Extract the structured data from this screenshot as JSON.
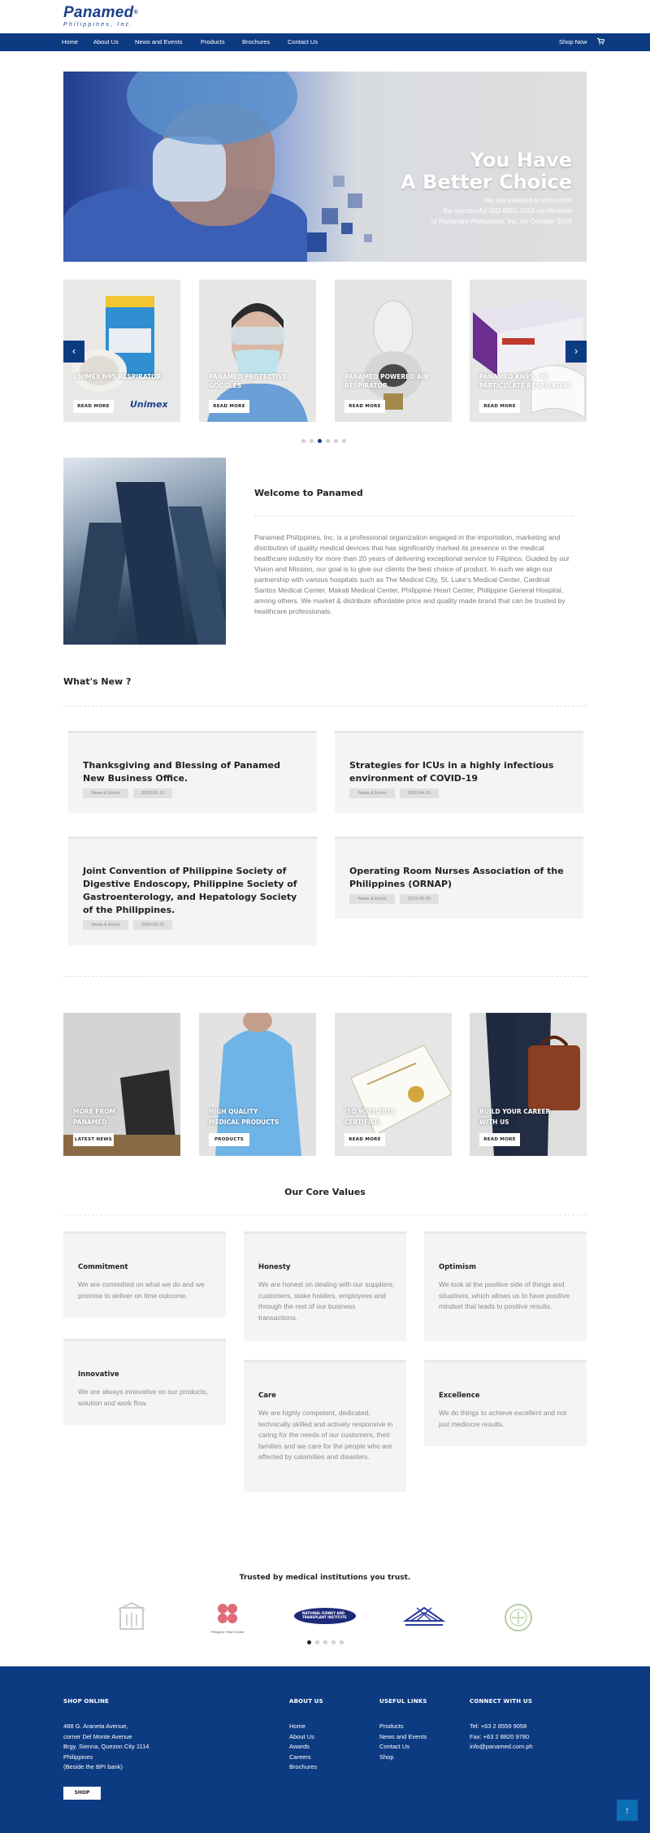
{
  "brand": {
    "name": "Panamed",
    "registered": "®",
    "subtitle": "Philippines, Inc."
  },
  "nav": {
    "items": [
      "Home",
      "About Us",
      "News and Events",
      "Products",
      "Brochures",
      "Contact Us"
    ],
    "shop": "Shop Now",
    "cart_icon": "cart-icon"
  },
  "hero": {
    "title_line1": "You Have",
    "title_line2": "A Better Choice",
    "text_line1": "We are pleased to announce",
    "text_line2": "the successful ISO 9001:2015 certification",
    "text_line3": "of Panamed Philippines, Inc. on October 2018"
  },
  "products": [
    {
      "label": "UNIMEX N95 RESPIRATOR",
      "button": "READ MORE",
      "brand_mark": "Unimex"
    },
    {
      "label": "PANAMED PROTECTIVE GOGGLES",
      "button": "READ MORE"
    },
    {
      "label": "PANAMED POWERED AIR RESPIRATOR",
      "button": "READ MORE"
    },
    {
      "label": "PANAMED KN95 - W PARTICULATE RESPIRATOR",
      "button": "READ MORE"
    }
  ],
  "carousel": {
    "prev_icon": "chevron-left-icon",
    "next_icon": "chevron-right-icon",
    "prev": "‹",
    "next": "›",
    "slide_count": 6,
    "active_index": 2
  },
  "welcome": {
    "title": "Welcome to Panamed",
    "text": "Panamed Philippines, Inc. is a professional organization engaged in the importation, marketing and distribution of quality medical  devices  that has significantly marked its presence in the medical healthcare industry for more than 20 years of delivering exceptional service to Filipinos. Guided by our Vision and Mission, our goal is to give our clients the best choice of product. In such we align our partnership with various hospitals such as The Medical City, St. Luke's Medical Center, Cardinal Santos Medical  Center, Makati Medical Center, Philippine Heart Center, Philippine General Hospital, among others. We market & distribute  affordable price and quality made brand that can be trusted by healthcare professionals."
  },
  "whats_new": {
    "heading": "What's New ?",
    "items": [
      {
        "title": "Thanksgiving and Blessing of Panamed New Business Office.",
        "tag": "News & Event",
        "date": "2020-05-19"
      },
      {
        "title": "Strategies for ICUs in a highly infectious environment of COVID-19",
        "tag": "News & Event",
        "date": "2020-04-15"
      },
      {
        "title": "Joint Convention of Philippine Society of Digestive Endoscopy, Philippine Society of Gastroenterology, and Hepatology Society of the Philippines.",
        "tag": "News & Event",
        "date": "2020-03-20"
      },
      {
        "title": "Operating Room Nurses Association of the Philippines (ORNAP)",
        "tag": "News & Event",
        "date": "2019-05-02"
      }
    ]
  },
  "promos": [
    {
      "line1": "MORE FROM",
      "line2": "PANAMED",
      "button": "LATEST NEWS"
    },
    {
      "line1": "HIGH QUALITY",
      "line2": "MEDICAL PRODUCTS",
      "button": "PRODUCTS"
    },
    {
      "line1": "ISO 9001:2015",
      "line2": "CERTIFIED",
      "button": "READ MORE"
    },
    {
      "line1": "BUILD YOUR CAREER",
      "line2": "WITH US",
      "button": "READ MORE"
    }
  ],
  "core_values": {
    "heading": "Our Core Values",
    "items": [
      {
        "title": "Commitment",
        "text": "We are committed on what we do and we promise to deliver on time outcome."
      },
      {
        "title": "Honesty",
        "text": "We are honest on dealing with our suppliers, customers, stake holders, employees and through the rest of our business transactions."
      },
      {
        "title": "Optimism",
        "text": "We look at the positive side of things and situations, which allows us to have positive mindset that leads to positive results."
      },
      {
        "title": "Innovative",
        "text": "We are always innovative on our products, solution and work flow."
      },
      {
        "title": "Care",
        "text": "We are highly competent, dedicated, technically skilled and actively responsive in caring for the needs of our customers, their families and we care for the people who are affected by calamities and disasters."
      },
      {
        "title": "Excellence",
        "text": "We do things to achieve excellent and not just mediocre results."
      }
    ]
  },
  "trusted": {
    "heading": "Trusted by medical institutions you trust.",
    "partners": [
      {
        "name": ""
      },
      {
        "name": "Philippine Heart Center"
      },
      {
        "name": "NATIONAL KIDNEY AND TRANSPLANT INSTITUTE"
      },
      {
        "name": ""
      },
      {
        "name": ""
      }
    ],
    "slide_count": 5,
    "active_index": 0
  },
  "footer": {
    "shop_online": {
      "heading": "SHOP ONLINE",
      "address": [
        "488 G. Araneta Avenue,",
        "corner Del Monte Avenue",
        "Brgy. Sienna, Quezon City 1114",
        "Philippines",
        "(Beside the BPI bank)"
      ],
      "button": "SHOP"
    },
    "about_us": {
      "heading": "ABOUT US",
      "links": [
        "Home",
        "About Us",
        "Awards",
        "Careers",
        "Brochures"
      ]
    },
    "useful_links": {
      "heading": "USEFUL LINKS",
      "links": [
        "Products",
        "News and Events",
        "Contact Us",
        "Shop"
      ]
    },
    "connect": {
      "heading": "CONNECT WITH US",
      "lines": [
        "Tel: +63 2 8559 9058",
        "Fax: +63 2 8820 9780",
        "info@panamed.com.ph"
      ]
    },
    "to_top": "↑"
  },
  "colors": {
    "primary": "#0d3b82",
    "footer": "#0d3b82",
    "to_top": "#0a6fb4"
  }
}
